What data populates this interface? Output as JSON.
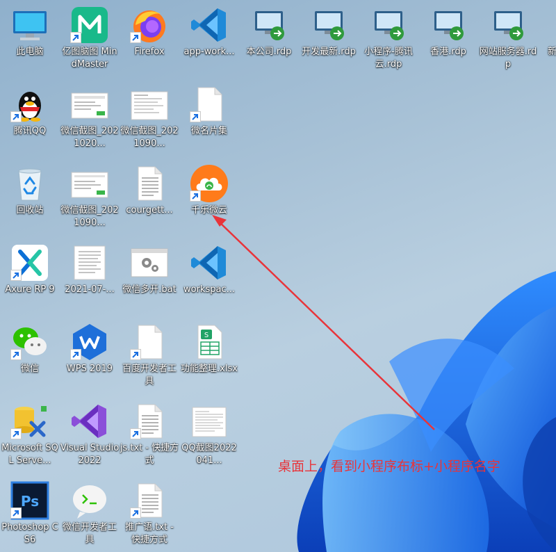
{
  "desktop": {
    "icons": {
      "this_pc": "此电脑",
      "mindmaster": "亿图脑图 MindMaster",
      "firefox": "Firefox",
      "vscode_app": "app-work...",
      "rdp_company": "本公司.rdp",
      "rdp_dev": "开发最新.rdp",
      "rdp_tencent": "小程序-腾讯云.rdp",
      "rdp_hk": "香港.rdp",
      "rdp_web": "网站服务器.rdp",
      "rdp_new": "新",
      "qq": "腾讯QQ",
      "shot1": "微信截图_2021020...",
      "shot2": "微信截图_2021090...",
      "weiming": "微名片集",
      "recycle": "回收站",
      "shot3": "微信截图_2021090...",
      "courgette": "courgett...",
      "qianle": "千乐微云",
      "axure": "Axure RP 9",
      "doc2021": "2021-07-...",
      "wechat_bat": "微信多开.bat",
      "workspace": "workspac...",
      "wechat": "微信",
      "wps": "WPS 2019",
      "baidu_tool": "百度开发者工具",
      "func_xlsx": "功能整理.xlsx",
      "sqlserver": "Microsoft SQL Serve...",
      "vstudio": "Visual Studio 2022",
      "js_txt": "js.txt - 快捷方式",
      "qq_shot": "QQ截图2022041...",
      "photoshop": "Photoshop CS6",
      "wx_dev": "微信开发者工具",
      "promo_txt": "推广语.txt - 快捷方式"
    },
    "annotation": "桌面上，看到小程序布标+小程序名字",
    "colors": {
      "annotation": "#e8343a",
      "accent_blue": "#1a6fe0"
    }
  }
}
